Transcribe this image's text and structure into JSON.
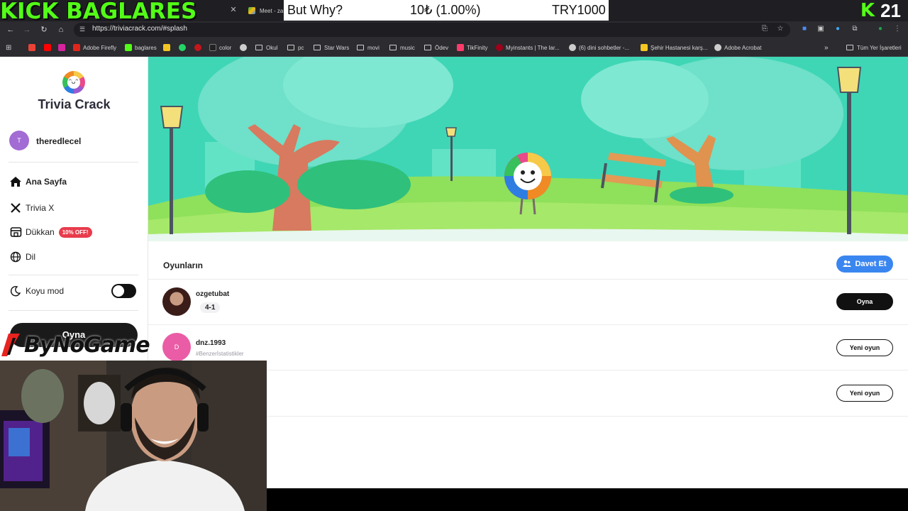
{
  "overlay": {
    "channel_label": "KICK BAGLARES",
    "ticker": {
      "left": "But Why?",
      "middle": "10₺ (1.00%)",
      "right": "TRY1000"
    },
    "kick_count": "21",
    "sponsor": "ByNoGame"
  },
  "browser": {
    "tabs": [
      {
        "label": "Meet - za",
        "color": "#34a853"
      }
    ],
    "url": "https://triviacrack.com/#splash",
    "bookmarks": [
      {
        "label": "",
        "icon": "gmail-icon",
        "color": "#ea4335"
      },
      {
        "label": "",
        "icon": "youtube-icon",
        "color": "#ff0000"
      },
      {
        "label": "",
        "icon": "instagram-icon",
        "color": "#d6249f"
      },
      {
        "label": "Adobe Firefly",
        "icon": "adobe-icon",
        "color": "#e1251b"
      },
      {
        "label": "baglares",
        "icon": "kick-icon",
        "color": "#53fc18"
      },
      {
        "label": "",
        "icon": "s-icon",
        "color": "#f3c623"
      },
      {
        "label": "",
        "icon": "whatsapp-icon",
        "color": "#25d366"
      },
      {
        "label": "",
        "icon": "red-icon",
        "color": "#c4161c"
      },
      {
        "label": "color",
        "icon": "color-icon",
        "color": "#222222"
      },
      {
        "label": "",
        "icon": "globe-icon",
        "color": "#cccccc"
      },
      {
        "label": "Okul",
        "icon": "folder-icon",
        "color": ""
      },
      {
        "label": "pc",
        "icon": "folder-icon",
        "color": ""
      },
      {
        "label": "Star Wars",
        "icon": "folder-icon",
        "color": ""
      },
      {
        "label": "movi",
        "icon": "folder-icon",
        "color": ""
      },
      {
        "label": "music",
        "icon": "folder-icon",
        "color": ""
      },
      {
        "label": "Ödev",
        "icon": "folder-icon",
        "color": ""
      },
      {
        "label": "TikFinity",
        "icon": "tikfinity-icon",
        "color": "#ff3b6b"
      },
      {
        "label": "Myinstants | The lar...",
        "icon": "myinstants-icon",
        "color": "#a0001a"
      },
      {
        "label": "(6) dini sohbetler -...",
        "icon": "globe-icon",
        "color": "#cccccc"
      },
      {
        "label": "Şehir Hastanesi karş...",
        "icon": "s-icon",
        "color": "#f3c623"
      },
      {
        "label": "Adobe Acrobat",
        "icon": "globe-icon",
        "color": "#cccccc"
      }
    ],
    "all_bookmarks": "Tüm Yer İşaretleri"
  },
  "sidebar": {
    "brand": "Trivia Crack",
    "user_initial": "T",
    "username": "theredlecel",
    "menu": [
      {
        "label": "Ana Sayfa",
        "icon": "home-icon",
        "bold": true
      },
      {
        "label": "Trivia X",
        "icon": "trivia-x-icon",
        "bold": false
      },
      {
        "label": "Dükkan",
        "icon": "shop-icon",
        "bold": false,
        "badge": "10% OFF!"
      },
      {
        "label": "Dil",
        "icon": "globe-icon",
        "bold": false
      }
    ],
    "dark_mode_label": "Koyu mod",
    "dark_mode_on": false,
    "play_label": "Oyna"
  },
  "games": {
    "title": "Oyunların",
    "invite_label": "Davet Et",
    "rows": [
      {
        "name": "ozgetubat",
        "score": "4-1",
        "sub": "",
        "avatar_initial": "",
        "button": "Oyna",
        "avatar_color": "#5a2a26"
      },
      {
        "name": "dnz.1993",
        "score": "",
        "sub": "#Benzerİstatistikler",
        "avatar_initial": "D",
        "button": "Yeni oyun",
        "avatar_color": "#ea5ca6"
      },
      {
        "name": "",
        "score": "",
        "sub": "",
        "avatar_initial": "",
        "button": "Yeni oyun",
        "avatar_color": ""
      }
    ]
  },
  "colors": {
    "kick_green": "#53fc18",
    "invite_blue": "#3a86f0",
    "banner_teal": "#37d3b2"
  }
}
